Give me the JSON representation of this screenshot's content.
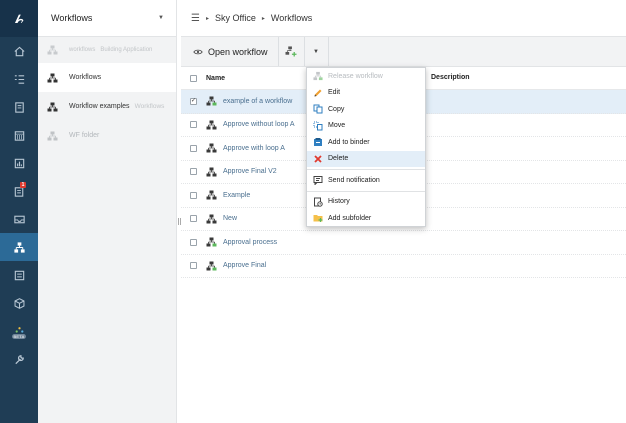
{
  "colors": {
    "rail": "#1f3d55",
    "rail_active": "#2c6a97",
    "selection": "#e3eef8",
    "delete_red": "#e03a2f",
    "add_green": "#5cb85c"
  },
  "rail": {
    "icons": [
      "home-icon",
      "list-icon",
      "document-icon",
      "calendar-icon",
      "chart-icon",
      "tasks-icon",
      "mail-icon",
      "workflow-icon",
      "form-icon",
      "cube-icon",
      "beta-icon",
      "wrench-icon"
    ],
    "tasks_badge": "1",
    "beta_label": "BETA"
  },
  "folder_panel": {
    "title": "Workflows",
    "sub_item": {
      "label": "workflows",
      "hint": "Building Application"
    },
    "items": [
      {
        "label": "Workflows",
        "hint": ""
      },
      {
        "label": "Workflow examples",
        "hint": "Workflows"
      },
      {
        "label": "WF folder",
        "hint": ""
      }
    ]
  },
  "breadcrumb": {
    "root": "Sky Office",
    "current": "Workflows"
  },
  "toolbar": {
    "open_label": "Open workflow"
  },
  "table": {
    "headers": {
      "name": "Name",
      "description": "Description"
    },
    "rows": [
      {
        "name": "example of a workflow",
        "checked": true,
        "released": true
      },
      {
        "name": "Approve without loop A",
        "checked": false,
        "released": false
      },
      {
        "name": "Approve with loop A",
        "checked": false,
        "released": false
      },
      {
        "name": "Approve Final V2",
        "checked": false,
        "released": false
      },
      {
        "name": "Example",
        "checked": false,
        "released": false
      },
      {
        "name": "New",
        "checked": false,
        "released": false
      },
      {
        "name": "Approval process",
        "checked": false,
        "released": true
      },
      {
        "name": "Approve Final",
        "checked": false,
        "released": true
      }
    ]
  },
  "context_menu": {
    "release": "Release workflow",
    "edit": "Edit",
    "copy": "Copy",
    "move": "Move",
    "add_to_binder": "Add to binder",
    "delete": "Delete",
    "send_notification": "Send notification",
    "history": "History",
    "add_subfolder": "Add subfolder"
  }
}
